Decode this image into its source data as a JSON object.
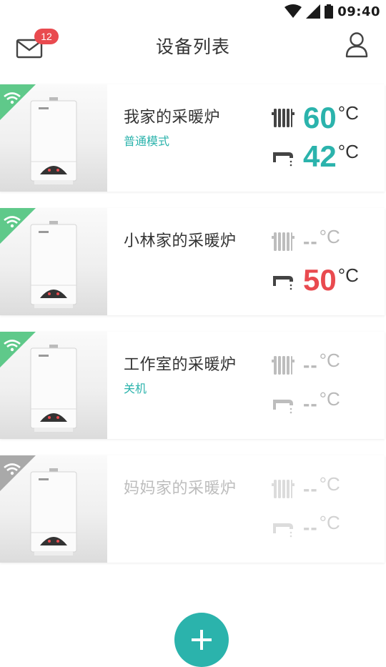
{
  "status_bar": {
    "time": "09:40"
  },
  "header": {
    "title": "设备列表",
    "unread_count": "12"
  },
  "colors": {
    "accent": "#2bb3ac",
    "alert": "#e94a4f",
    "offline": "#b0b0b0"
  },
  "devices": [
    {
      "name": "我家的采暖炉",
      "status": "普通模式",
      "online": true,
      "heating": {
        "value": "60",
        "unit": "°C"
      },
      "hot_water": {
        "value": "42",
        "unit": "°C"
      }
    },
    {
      "name": "小林家的采暖炉",
      "status": "",
      "online": true,
      "heating": {
        "value": "--",
        "unit": "°C"
      },
      "hot_water": {
        "value": "50",
        "unit": "°C"
      }
    },
    {
      "name": "工作室的采暖炉",
      "status": "关机",
      "online": true,
      "heating": {
        "value": "--",
        "unit": "°C"
      },
      "hot_water": {
        "value": "--",
        "unit": "°C"
      }
    },
    {
      "name": "妈妈家的采暖炉",
      "status": "",
      "online": false,
      "heating": {
        "value": "--",
        "unit": "°C"
      },
      "hot_water": {
        "value": "--",
        "unit": "°C"
      }
    }
  ],
  "icons": {
    "mail": "mail-icon",
    "user": "user-icon",
    "wifi": "wifi-icon",
    "radiator": "radiator-icon",
    "faucet": "faucet-icon",
    "add": "plus-icon"
  }
}
